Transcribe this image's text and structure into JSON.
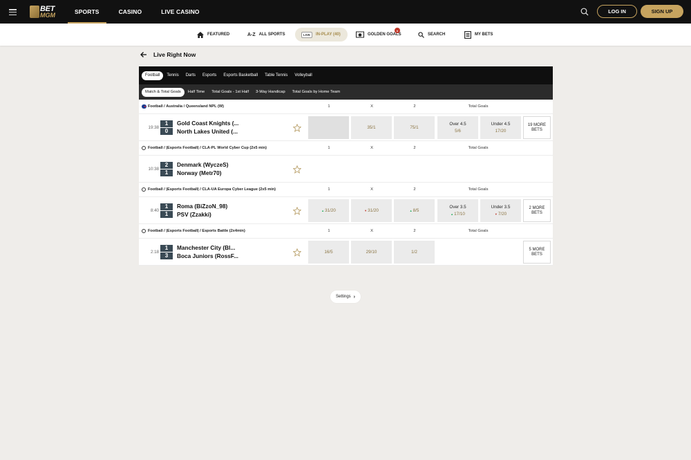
{
  "header": {
    "logo": "BET MGM",
    "nav": [
      {
        "label": "SPORTS",
        "active": true
      },
      {
        "label": "CASINO",
        "active": false
      },
      {
        "label": "LIVE CASINO",
        "active": false
      }
    ],
    "login_label": "LOG IN",
    "signup_label": "SIGN UP",
    "icons": [
      "menu-icon",
      "search-icon"
    ]
  },
  "subnav": {
    "featured": "FEATURED",
    "all_sports": "ALL SPORTS",
    "live_badge": "LIVE",
    "inplay": "IN-PLAY (40)",
    "golden_goals": "GOLDEN GOALS",
    "search": "SEARCH",
    "my_bets": "MY BETS"
  },
  "page_title": "Live Right Now",
  "sport_tabs": [
    {
      "label": "Football",
      "active": true
    },
    {
      "label": "Tennis",
      "active": false
    },
    {
      "label": "Darts",
      "active": false
    },
    {
      "label": "Esports",
      "active": false
    },
    {
      "label": "Esports Basketball",
      "active": false
    },
    {
      "label": "Table Tennis",
      "active": false
    },
    {
      "label": "Volleyball",
      "active": false
    }
  ],
  "market_tabs": [
    {
      "label": "Match & Total Goals",
      "active": true
    },
    {
      "label": "Half Time",
      "active": false
    },
    {
      "label": "Total Goals - 1st Half",
      "active": false
    },
    {
      "label": "3-Way Handicap",
      "active": false
    },
    {
      "label": "Total Goals by Home Team",
      "active": false
    }
  ],
  "columns": {
    "c1": "1",
    "cx": "X",
    "c2": "2",
    "total": "Total Goals"
  },
  "sections": [
    {
      "league": "Football / Australia / Queensland NPL (W)",
      "time": "19:38",
      "score": [
        "1",
        "0"
      ],
      "team1": "Gold Coast Knights (...",
      "team2": "North Lakes United (...",
      "odds": [
        "",
        "35/1",
        "75/1"
      ],
      "over": {
        "label": "Over  4.5",
        "odds": "5/6"
      },
      "under": {
        "label": "Under  4.5",
        "odds": "17/20"
      },
      "more": "19 MORE BETS"
    },
    {
      "league": "Football / |Esports Football| / CLA-PL World Cyber Cup (2x5 min)",
      "time": "10:38",
      "score": [
        "2",
        "1"
      ],
      "team1": "Denmark (WyczeS)",
      "team2": "Norway (Metr70)"
    },
    {
      "league": "Football / |Esports Football| / CLA-UA Europa Cyber League (2x5 min)",
      "time": "8:40",
      "score": [
        "1",
        "1"
      ],
      "team1": "Roma (BiZzoN_98)",
      "team2": "PSV (Zzakki)",
      "odds": [
        "31/20",
        "31/20",
        "8/5"
      ],
      "over": {
        "label": "Over  3.5",
        "odds": "17/10"
      },
      "under": {
        "label": "Under  3.5",
        "odds": "7/20"
      },
      "more": "2 MORE BETS"
    },
    {
      "league": "Football / |Esports Football| / Esports Battle (2x4min)",
      "time": "2:18",
      "score": [
        "1",
        "3"
      ],
      "team1": "Manchester City (Bl...",
      "team2": "Boca Juniors (RossF...",
      "odds": [
        "16/5",
        "29/10",
        "1/2"
      ],
      "more": "5 MORE BETS"
    }
  ],
  "settings_label": "Settings",
  "colors": {
    "accent": "#c7a45f",
    "dark": "#111111",
    "score_bg": "#3a4a55"
  }
}
